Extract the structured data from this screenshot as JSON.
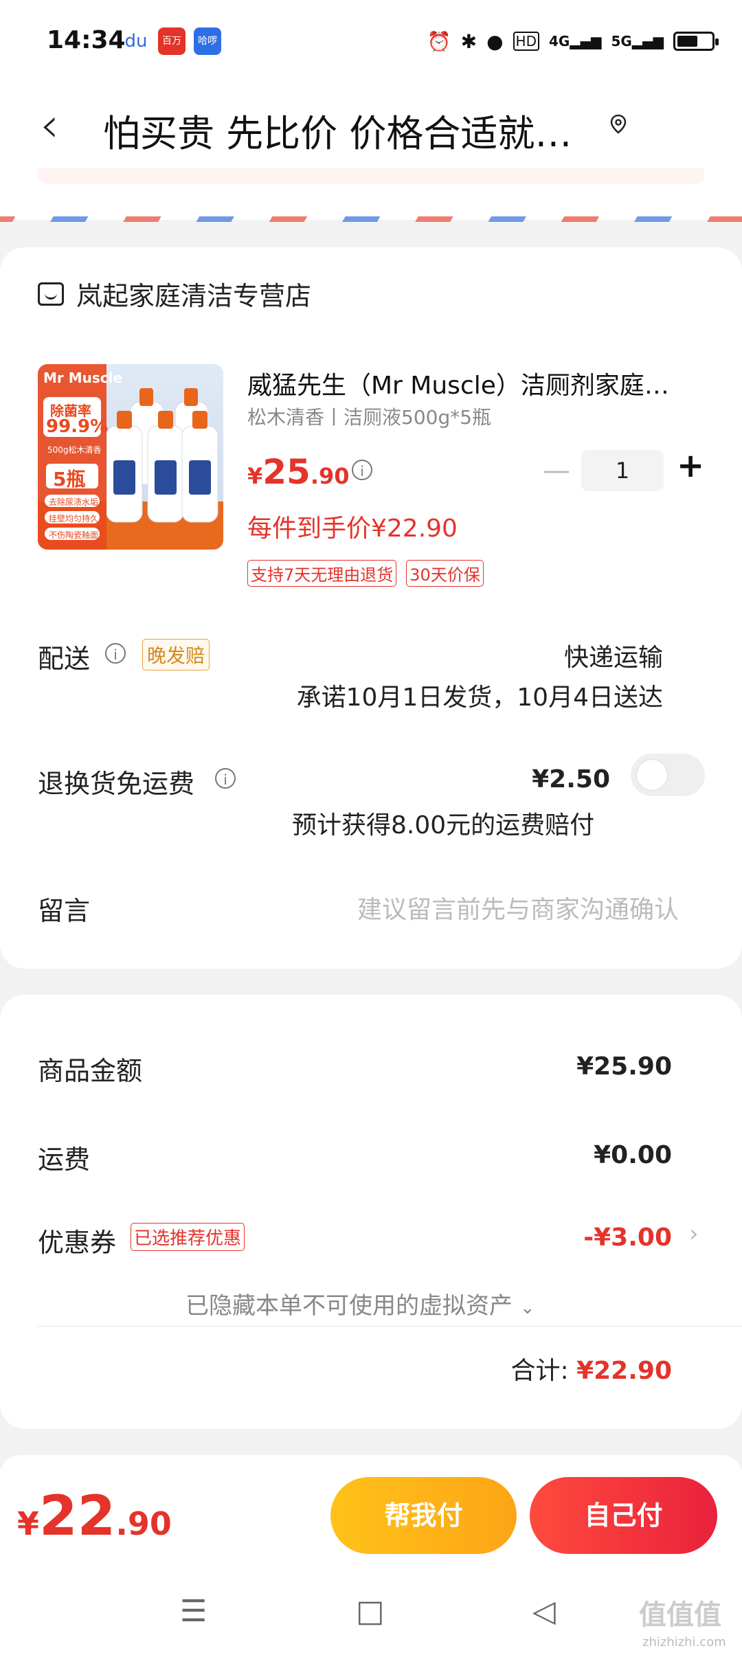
{
  "status_bar": {
    "time": "14:34",
    "apps": [
      "du",
      "百万",
      "哈啰"
    ],
    "network": [
      "4G",
      "5G"
    ],
    "battery_level": 0.6
  },
  "header": {
    "title": "怕买贵 先比价 价格合适就…",
    "back_icon": "chevron-left-icon",
    "location_icon": "location-pin-icon"
  },
  "store": {
    "name": "岚起家庭清洁专营店"
  },
  "product": {
    "name": "威猛先生（Mr Muscle）洁厕剂家庭…",
    "spec": "松木清香丨洁厕液500g*5瓶",
    "price_currency": "¥",
    "price_integer": "25",
    "price_decimal": ".90",
    "quantity": "1",
    "per_item_price": "每件到手价¥22.90",
    "tags": [
      "支持7天无理由退货",
      "30天价保"
    ],
    "image_text": {
      "brand": "Mr Muscle",
      "badge1": "除菌率",
      "badge2": "99.9%",
      "badge3": "500g松木清香",
      "badge4": "5瓶",
      "features": [
        "去除尿渍水垢",
        "挂壁均匀持久",
        "不伤陶瓷釉面"
      ]
    }
  },
  "delivery": {
    "label": "配送",
    "tag": "晚发赔",
    "method": "快递运输",
    "promise": "承诺10月1日发货，10月4日送达"
  },
  "return_shipping": {
    "label": "退换货免运费",
    "price": "¥2.50",
    "note": "预计获得8.00元的运费赔付",
    "enabled": false
  },
  "message": {
    "label": "留言",
    "placeholder": "建议留言前先与商家沟通确认"
  },
  "summary": {
    "goods_label": "商品金额",
    "goods_value": "¥25.90",
    "shipping_label": "运费",
    "shipping_value": "¥0.00",
    "coupon_label": "优惠券",
    "coupon_tag": "已选推荐优惠",
    "coupon_value": "-¥3.00",
    "hidden_note": "已隐藏本单不可使用的虚拟资产",
    "total_label": "合计:",
    "total_value": "¥22.90"
  },
  "bottom": {
    "currency": "¥",
    "total_integer": "22",
    "total_decimal": ".90",
    "help_pay": "帮我付",
    "self_pay": "自己付"
  },
  "watermark": {
    "text": "值值值",
    "url": "zhizhizhi.com"
  },
  "colors": {
    "accent_red": "#e4332a",
    "help_yellow": "#fdb417",
    "tag_orange": "#d58a1d"
  }
}
